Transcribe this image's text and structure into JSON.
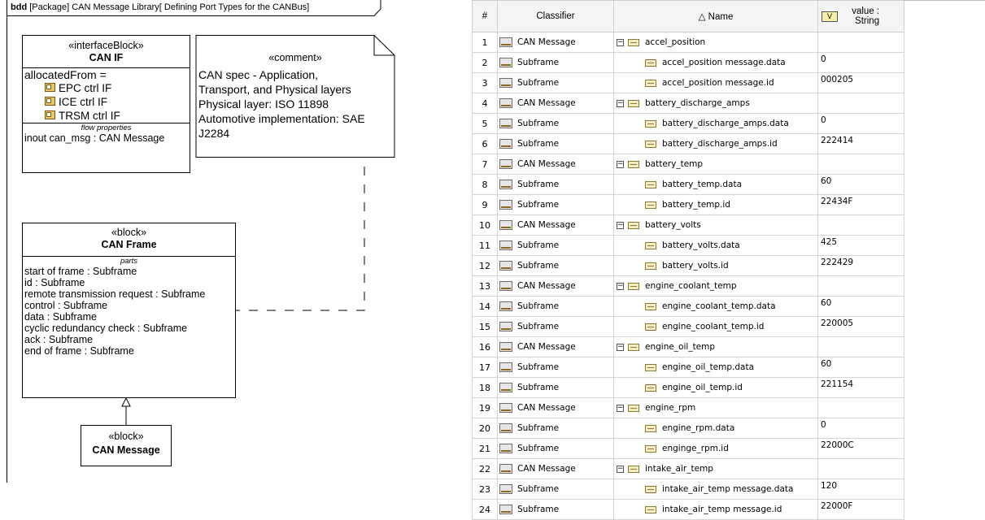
{
  "diagram": {
    "frame_kind": "bdd",
    "frame_title": "[Package] CAN Message Library[ Defining Port Types for the CANBus]",
    "interface_block": {
      "stereotype": "«interfaceBlock»",
      "name": "CAN IF",
      "allocated_label": "allocatedFrom =",
      "allocated_items": [
        "EPC ctrl IF",
        "ICE ctrl IF",
        "TRSM ctrl IF"
      ],
      "compartment_title": "flow properties",
      "flow_property": "inout can_msg : CAN Message"
    },
    "comment": {
      "stereotype": "«comment»",
      "lines": [
        "CAN spec - Application,",
        "Transport, and Physical layers",
        "Physical layer: ISO 11898",
        "Automotive implementation: SAE",
        "J2284"
      ]
    },
    "can_frame": {
      "stereotype": "«block»",
      "name": "CAN Frame",
      "compartment_title": "parts",
      "parts": [
        "start of frame : Subframe",
        "id : Subframe",
        "remote transmission request : Subframe",
        "control : Subframe",
        "data : Subframe",
        "cyclic redundancy check : Subframe",
        "ack : Subframe",
        "end of frame : Subframe"
      ]
    },
    "can_message": {
      "stereotype": "«block»",
      "name": "CAN Message"
    }
  },
  "table": {
    "headers": {
      "num": "#",
      "classifier": "Classifier",
      "name": "△ Name",
      "value_icon": "V",
      "value_line1": "value :",
      "value_line2": "String"
    },
    "rows": [
      {
        "n": "1",
        "cls": "CAN Message",
        "name": "accel_position",
        "value": "",
        "group": true
      },
      {
        "n": "2",
        "cls": "Subframe",
        "name": "accel_position message.data",
        "value": "0",
        "group": false
      },
      {
        "n": "3",
        "cls": "Subframe",
        "name": "accel_position message.id",
        "value": "000205",
        "group": false
      },
      {
        "n": "4",
        "cls": "CAN Message",
        "name": "battery_discharge_amps",
        "value": "",
        "group": true
      },
      {
        "n": "5",
        "cls": "Subframe",
        "name": "battery_discharge_amps.data",
        "value": "0",
        "group": false
      },
      {
        "n": "6",
        "cls": "Subframe",
        "name": "battery_discharge_amps.id",
        "value": "222414",
        "group": false
      },
      {
        "n": "7",
        "cls": "CAN Message",
        "name": "battery_temp",
        "value": "",
        "group": true
      },
      {
        "n": "8",
        "cls": "Subframe",
        "name": "battery_temp.data",
        "value": "60",
        "group": false
      },
      {
        "n": "9",
        "cls": "Subframe",
        "name": "battery_temp.id",
        "value": "22434F",
        "group": false
      },
      {
        "n": "10",
        "cls": "CAN Message",
        "name": "battery_volts",
        "value": "",
        "group": true
      },
      {
        "n": "11",
        "cls": "Subframe",
        "name": "battery_volts.data",
        "value": "425",
        "group": false
      },
      {
        "n": "12",
        "cls": "Subframe",
        "name": "battery_volts.id",
        "value": "222429",
        "group": false
      },
      {
        "n": "13",
        "cls": "CAN Message",
        "name": "engine_coolant_temp",
        "value": "",
        "group": true
      },
      {
        "n": "14",
        "cls": "Subframe",
        "name": "engine_coolant_temp.data",
        "value": "60",
        "group": false
      },
      {
        "n": "15",
        "cls": "Subframe",
        "name": "engine_coolant_temp.id",
        "value": "220005",
        "group": false
      },
      {
        "n": "16",
        "cls": "CAN Message",
        "name": "engine_oil_temp",
        "value": "",
        "group": true
      },
      {
        "n": "17",
        "cls": "Subframe",
        "name": "engine_oil_temp.data",
        "value": "60",
        "group": false
      },
      {
        "n": "18",
        "cls": "Subframe",
        "name": "engine_oil_temp.id",
        "value": "221154",
        "group": false
      },
      {
        "n": "19",
        "cls": "CAN Message",
        "name": "engine_rpm",
        "value": "",
        "group": true
      },
      {
        "n": "20",
        "cls": "Subframe",
        "name": "engine_rpm.data",
        "value": "0",
        "group": false
      },
      {
        "n": "21",
        "cls": "Subframe",
        "name": "enginge_rpm.id",
        "value": "22000C",
        "group": false
      },
      {
        "n": "22",
        "cls": "CAN Message",
        "name": "intake_air_temp",
        "value": "",
        "group": true
      },
      {
        "n": "23",
        "cls": "Subframe",
        "name": "intake_air_temp message.data",
        "value": "120",
        "group": false
      },
      {
        "n": "24",
        "cls": "Subframe",
        "name": "intake_air_temp message.id",
        "value": "22000F",
        "group": false
      }
    ]
  }
}
